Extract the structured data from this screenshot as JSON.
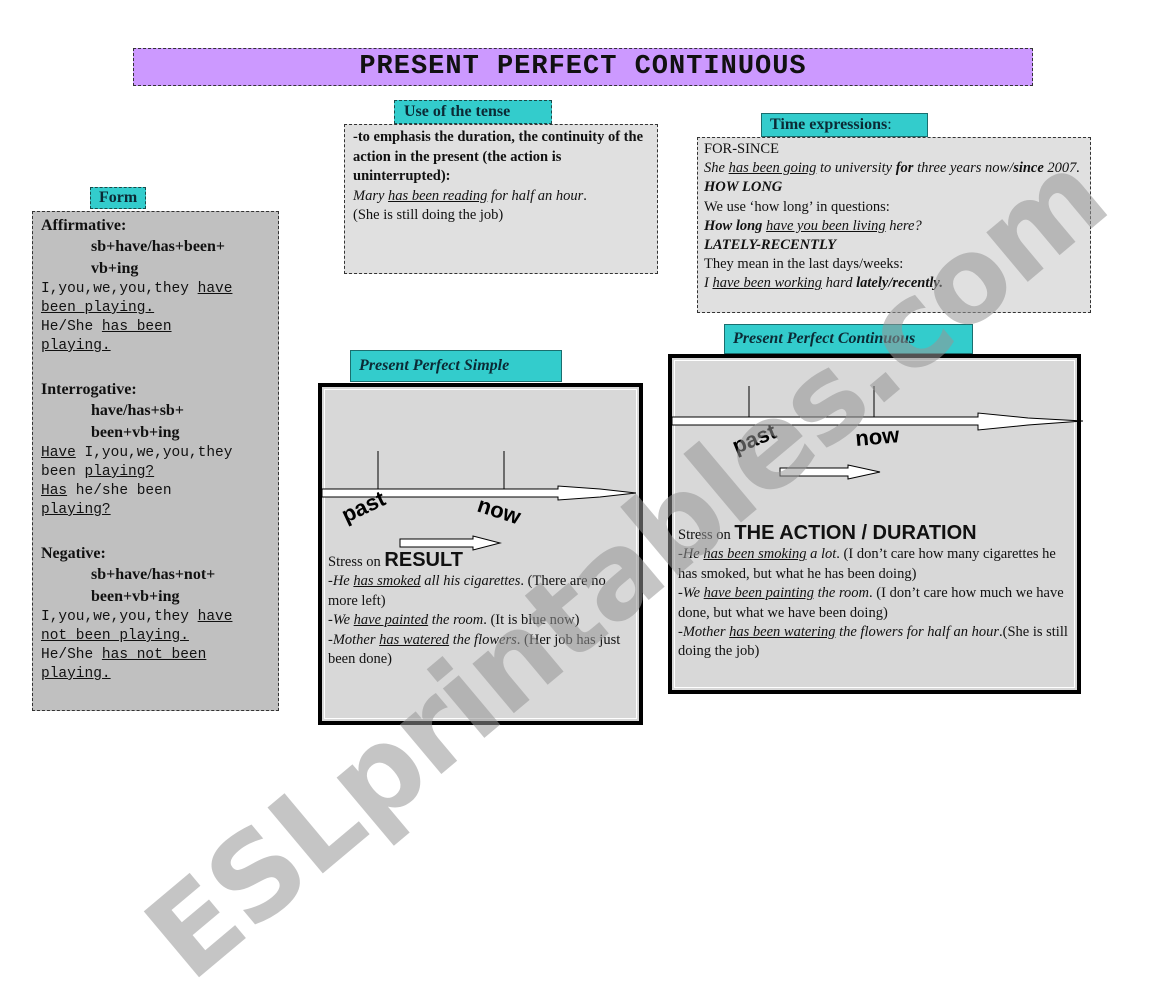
{
  "title": "PRESENT PERFECT CONTINUOUS",
  "form": {
    "label": "Form",
    "sections": [
      {
        "heading": "Affirmative",
        "rule_line1": "sb+have/has+been+",
        "rule_line2": "vb+ing",
        "example_lines": [
          {
            "plain": "I,you,we,you,they ",
            "underlined": "have"
          },
          {
            "plain": "",
            "underlined": "been playing."
          },
          {
            "plain": "He/She ",
            "underlined": "has been"
          },
          {
            "plain": "",
            "underlined": "playing."
          }
        ]
      },
      {
        "heading": "Interrogative",
        "rule_line1": "have/has+sb+",
        "rule_line2": "been+vb+ing",
        "example_lines": [
          {
            "underlined_first": "Have",
            "plain": " I,you,we,you,they"
          },
          {
            "plain": "been ",
            "underlined": "playing?"
          },
          {
            "underlined_first": "Has",
            "plain": " he/she been"
          },
          {
            "plain": "",
            "underlined": "playing?"
          }
        ]
      },
      {
        "heading": "Negative",
        "rule_line1": "sb+have/has+not+",
        "rule_line2": "been+vb+ing",
        "example_lines": [
          {
            "plain": "I,you,we,you,they ",
            "underlined": "have"
          },
          {
            "plain": "",
            "underlined": "not been playing."
          },
          {
            "plain": "He/She ",
            "underlined": "has not been"
          },
          {
            "plain": "",
            "underlined": "playing."
          }
        ]
      }
    ]
  },
  "use": {
    "label": "Use of the tense",
    "definition": "-to emphasis the duration, the continuity of the action in the present (the action is uninterrupted):",
    "example": {
      "subject": "Mary ",
      "verb": "has been reading",
      "rest": " for half an hour",
      "end": "."
    },
    "note": "(She is still doing the job)"
  },
  "time_expressions": {
    "label": "Time expressions",
    "for_since": {
      "heading": "FOR-SINCE",
      "ex_a": "She ",
      "ex_verb": "has been going",
      "ex_b": " to university ",
      "ex_for": "for",
      "ex_c": " three years now/",
      "ex_since": "since",
      "ex_d": " 2007."
    },
    "how_long": {
      "heading": "HOW LONG",
      "note": "We use ‘how long’ in questions:",
      "ex_bold": "How long",
      "ex_verb": "have you been living",
      "ex_rest": " here?"
    },
    "lately": {
      "heading": "LATELY-RECENTLY",
      "note": "They mean in the last days/weeks:",
      "ex_a": "I ",
      "ex_verb": "have been working",
      "ex_b": " hard ",
      "ex_bold": "lately/recently."
    }
  },
  "simple": {
    "label": "Present Perfect Simple",
    "timeline": {
      "past": "past",
      "now": "now"
    },
    "stress_prefix": "Stress on ",
    "stress_word": "RESULT",
    "examples": [
      {
        "pre": "-He ",
        "verb": "has smoked",
        "post": " all his cigarettes",
        "note": ". (There are no more left)"
      },
      {
        "pre": "-We ",
        "verb": "have painted",
        "post": " the room",
        "note": ". (It is blue now)"
      },
      {
        "pre": "-Mother ",
        "verb": "has watered",
        "post": " the flowers",
        "note": ". (Her job has just been done)"
      }
    ]
  },
  "continuous": {
    "label": "Present Perfect Continuous",
    "timeline": {
      "past": "past",
      "now": "now"
    },
    "stress_prefix": "Stress on ",
    "stress_word": "THE ACTION / DURATION",
    "examples": [
      {
        "pre": "-He ",
        "verb": "has been smoking",
        "post": " a lot",
        "note": ". (I don’t care how many cigarettes he has smoked, but what he has been doing)"
      },
      {
        "pre": "-We ",
        "verb": "have been painting",
        "post": " the room",
        "note": ". (I don’t care how much we have done, but what we have been doing)"
      },
      {
        "pre": "-Mother ",
        "verb": "has been watering",
        "post": " the flowers for half an hour",
        "note": ".(She is still doing the job)"
      }
    ]
  },
  "watermark": "ESLprintables.com",
  "colors": {
    "banner": "#cc99ff",
    "label": "#33cccc",
    "form_box": "#c0c0c0",
    "info_box": "#e0e0e0",
    "frame_fill": "#d8d8d8"
  }
}
